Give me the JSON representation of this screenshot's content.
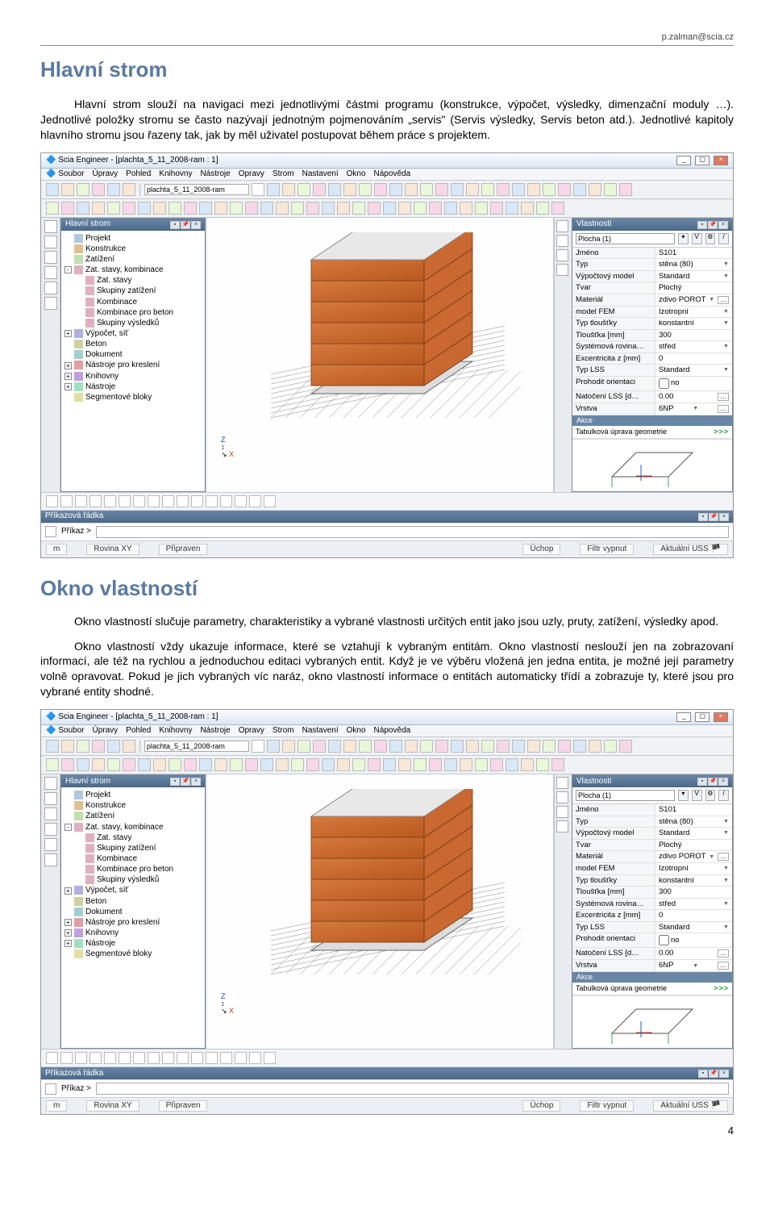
{
  "header": {
    "email": "p.zalman@scia.cz"
  },
  "section1": {
    "title": "Hlavní strom",
    "p1": "Hlavní strom slouží na navigaci mezi jednotlivými částmi programu (konstrukce, výpočet, výsledky, dimenzační moduly …). Jednotlivé položky stromu se často nazývají jednotným pojmenováním „servis\" (Servis výsledky, Servis beton atd.). Jednotlivé kapitoly hlavního stromu jsou řazeny tak, jak by měl uživatel postupovat během práce s projektem."
  },
  "section2": {
    "title": "Okno vlastností",
    "p1": "Okno vlastností slučuje parametry, charakteristiky a vybrané vlastnosti určitých entit jako jsou uzly, pruty, zatížení, výsledky apod.",
    "p2": "Okno vlastností vždy ukazuje informace, které se vztahují k vybraným entitám. Okno vlastností neslouží jen na zobrazovaní informací, ale též na rychlou a jednoduchou editaci vybraných entit. Když je ve výběru vložená jen jedna entita, je možné její parametry volně opravovat. Pokud je jich vybraných víc naráz, okno vlastností informace o entitách automaticky třídí a zobrazuje ty, které jsou pro vybrané entity shodné."
  },
  "app": {
    "title": "Scia Engineer - [plachta_5_11_2008-ram : 1]",
    "menus": [
      "Soubor",
      "Úpravy",
      "Pohled",
      "Knihovny",
      "Nástroje",
      "Opravy",
      "Strom",
      "Nastavení",
      "Okno",
      "Nápověda"
    ],
    "fileField": "plachta_5_11_2008-ram",
    "treePanel": "Hlavní strom",
    "tree": [
      {
        "label": "Projekt",
        "ico": "pj"
      },
      {
        "label": "Konstrukce",
        "ico": "kn"
      },
      {
        "label": "Zatížení",
        "ico": "zt"
      },
      {
        "label": "Zat. stavy, kombinace",
        "ico": "zs",
        "exp": "-",
        "children": [
          {
            "label": "Zat. stavy",
            "ico": "zs"
          },
          {
            "label": "Skupiny zatížení",
            "ico": "zs"
          },
          {
            "label": "Kombinace",
            "ico": "zs"
          },
          {
            "label": "Kombinace pro beton",
            "ico": "zs"
          },
          {
            "label": "Skupiny výsledků",
            "ico": "zs"
          }
        ]
      },
      {
        "label": "Výpočet, síť",
        "ico": "vp",
        "exp": "+"
      },
      {
        "label": "Beton",
        "ico": "bt"
      },
      {
        "label": "Dokument",
        "ico": "dk"
      },
      {
        "label": "Nástroje pro kreslení",
        "ico": "nk",
        "exp": "+"
      },
      {
        "label": "Knihovny",
        "ico": "kh",
        "exp": "+"
      },
      {
        "label": "Nástroje",
        "ico": "ns",
        "exp": "+"
      },
      {
        "label": "Segmentové bloky",
        "ico": "sb"
      }
    ],
    "propPanel": "Vlastnosti",
    "propSelector": "Plocha (1)",
    "properties": [
      {
        "k": "Jméno",
        "v": "S101"
      },
      {
        "k": "Typ",
        "v": "stěna (80)",
        "dd": true
      },
      {
        "k": "Výpočtový model",
        "v": "Standard",
        "dd": true
      },
      {
        "k": "Tvar",
        "v": "Plochý"
      },
      {
        "k": "Materiál",
        "v": "zdivo POROT",
        "dd": true,
        "dots": true
      },
      {
        "k": "model FEM",
        "v": "Izotropní",
        "dd": true
      },
      {
        "k": "Typ tloušťky",
        "v": "konstantní",
        "dd": true
      },
      {
        "k": "Tloušťka [mm]",
        "v": "300"
      },
      {
        "k": "Systémová rovina…",
        "v": "střed",
        "dd": true
      },
      {
        "k": "Excentricita z [mm]",
        "v": "0"
      },
      {
        "k": "Typ LSS",
        "v": "Standard",
        "dd": true
      },
      {
        "k": "Prohodit orientaci",
        "v": "",
        "chk": true,
        "chkLabel": "no"
      },
      {
        "k": "Natočení LSS [d…",
        "v": "0.00",
        "dots": true
      },
      {
        "k": "Vrstva",
        "v": "6NP",
        "dd": true,
        "dots": true
      }
    ],
    "akce": "Akce",
    "akceRow": "Tabulková úprava geometrie",
    "akceGo": ">>>",
    "cmdPanel": "Příkazová řádka",
    "cmdLabel": "Příkaz >",
    "status": {
      "m": "m",
      "plane": "Rovina XY",
      "ready": "Připraven",
      "snap": "Úchop",
      "filter": "Filtr vypnut",
      "ucs": "Aktuální USS"
    }
  },
  "pageNumber": "4"
}
